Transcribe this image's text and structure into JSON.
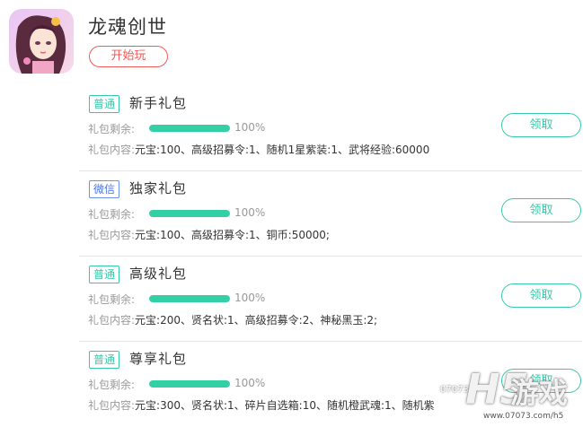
{
  "game": {
    "title": "龙魂创世",
    "play_label": "开始玩"
  },
  "labels": {
    "remain": "礼包剩余:",
    "content": "礼包内容:",
    "claim": "领取"
  },
  "gifts": [
    {
      "tag": "普通",
      "name": "新手礼包",
      "remain_percent": 100,
      "remain_text": "100%",
      "content": "元宝:100、高级招募令:1、随机1星紫装:1、武将经验:60000"
    },
    {
      "tag": "微信",
      "name": "独家礼包",
      "remain_percent": 100,
      "remain_text": "100%",
      "content": "元宝:100、高级招募令:1、铜币:50000;"
    },
    {
      "tag": "普通",
      "name": "高级礼包",
      "remain_percent": 100,
      "remain_text": "100%",
      "content": "元宝:200、贤名状:1、高级招募令:2、神秘黑玉:2;"
    },
    {
      "tag": "普通",
      "name": "尊享礼包",
      "remain_percent": 100,
      "remain_text": "100%",
      "content": "元宝:300、贤名状:1、碎片自选箱:10、随机橙武魂:1、随机紫"
    }
  ],
  "watermark": {
    "brand": "H5",
    "brand_cn": "游戏",
    "site_logo": "07073",
    "url": "www.07073.com/h5"
  },
  "colors": {
    "accent_green": "#38c8a8",
    "bar_fill": "#33cfa5",
    "play_red": "#f05a5a",
    "wechat_blue": "#4b74e8"
  }
}
